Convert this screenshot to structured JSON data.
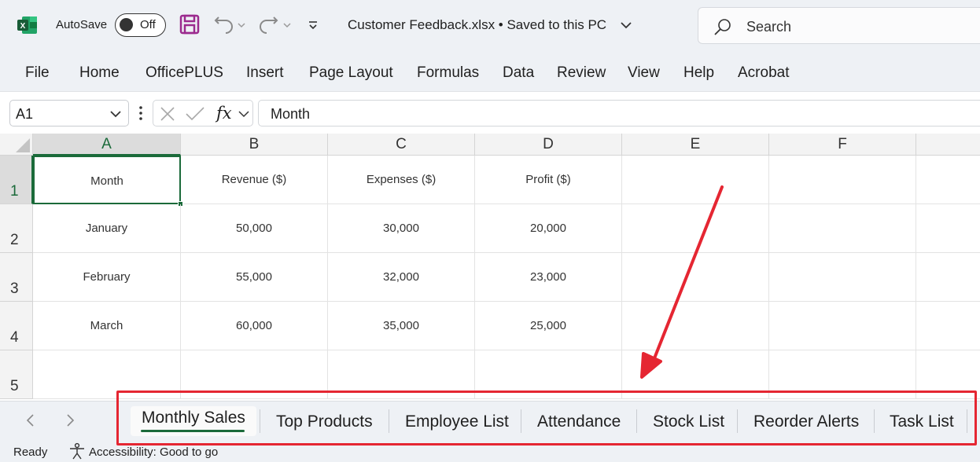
{
  "titlebar": {
    "autosave_label": "AutoSave",
    "autosave_state": "Off",
    "file_title": "Customer Feedback.xlsx • Saved to this PC",
    "search_placeholder": "Search"
  },
  "menu": {
    "items": [
      "File",
      "Home",
      "OfficePLUS",
      "Insert",
      "Page Layout",
      "Formulas",
      "Data",
      "Review",
      "View",
      "Help",
      "Acrobat"
    ]
  },
  "formula_bar": {
    "name_box": "A1",
    "fx_label": "fx",
    "content": "Month"
  },
  "grid": {
    "columns": [
      "A",
      "B",
      "C",
      "D",
      "E",
      "F"
    ],
    "rows": [
      "1",
      "2",
      "3",
      "4",
      "5"
    ],
    "cells": [
      [
        "Month",
        "Revenue ($)",
        "Expenses ($)",
        "Profit ($)",
        "",
        ""
      ],
      [
        "January",
        "50,000",
        "30,000",
        "20,000",
        "",
        ""
      ],
      [
        "February",
        "55,000",
        "32,000",
        "23,000",
        "",
        ""
      ],
      [
        "March",
        "60,000",
        "35,000",
        "25,000",
        "",
        ""
      ],
      [
        "",
        "",
        "",
        "",
        "",
        ""
      ]
    ],
    "selected_cell": "A1"
  },
  "sheets": {
    "tabs": [
      "Monthly Sales",
      "Top Products",
      "Employee List",
      "Attendance",
      "Stock List",
      "Reorder Alerts",
      "Task List"
    ],
    "active": "Monthly Sales"
  },
  "status": {
    "ready": "Ready",
    "accessibility": "Accessibility: Good to go"
  },
  "colors": {
    "excel_green": "#1b6a3a",
    "annotation_red": "#e52632",
    "save_icon": "#9b2a8e"
  }
}
